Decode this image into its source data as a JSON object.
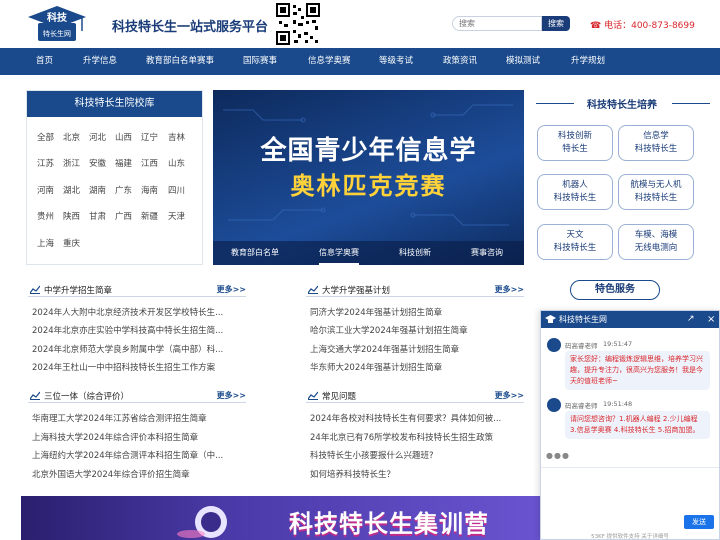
{
  "header": {
    "logo_text_top": "科技",
    "logo_text_bottom": "特长生网",
    "site_title": "科技特长生一站式服务平台",
    "search_placeholder": "搜索",
    "search_button": "搜索",
    "phone": "电话：400-873-8699"
  },
  "nav": [
    "首页",
    "升学信息",
    "教育部白名单赛事",
    "国际赛事",
    "信息学奥赛",
    "等级考试",
    "政策资讯",
    "模拟测试",
    "升学规划"
  ],
  "library": {
    "title": "科技特长生院校库",
    "provinces": [
      "全部",
      "北京",
      "河北",
      "山西",
      "辽宁",
      "吉林",
      "江苏",
      "浙江",
      "安徽",
      "福建",
      "江西",
      "山东",
      "河南",
      "湖北",
      "湖南",
      "广东",
      "海南",
      "四川",
      "贵州",
      "陕西",
      "甘肃",
      "广西",
      "新疆",
      "天津",
      "上海",
      "重庆"
    ]
  },
  "banner": {
    "line1": "全国青少年信息学",
    "line2": "奥林匹克竞赛",
    "tabs": [
      "教育部白名单",
      "信息学奥赛",
      "科技创新",
      "赛事咨询"
    ],
    "active_tab": "信息学奥赛"
  },
  "cultivation": {
    "title": "科技特长生培养",
    "items": [
      [
        "科技创新",
        "特长生"
      ],
      [
        "信息学",
        "科技特长生"
      ],
      [
        "机器人",
        "科技特长生"
      ],
      [
        "航模与无人机",
        "科技特长生"
      ],
      [
        "天文",
        "科技特长生"
      ],
      [
        "车模、海模",
        "无线电测向"
      ]
    ]
  },
  "sections": {
    "more_label": "更多>>",
    "middle_school": {
      "title": "中学升学招生简章",
      "items": [
        "2024年人大附中北京经济技术开发区学校特长生...",
        "2024年北京亦庄实验中学科技高中特长生招生简...",
        "2024年北京师范大学良乡附属中学（高中部）科...",
        "2024年王杜山一中中招科技特长生招生工作方案"
      ]
    },
    "university": {
      "title": "大学升学强基计划",
      "items": [
        "同济大学2024年强基计划招生简章",
        "哈尔滨工业大学2024年强基计划招生简章",
        "上海交通大学2024年强基计划招生简章",
        "华东师大2024年强基计划招生简章"
      ]
    },
    "comprehensive": {
      "title": "三位一体（综合评价）",
      "items": [
        "华南理工大学2024年江苏省综合测评招生简章",
        "上海科技大学2024年综合评价本科招生简章",
        "上海纽约大学2024年综合测评本科招生简章（中...",
        "北京外国语大学2024年综合评价招生简章"
      ]
    },
    "faq": {
      "title": "常见问题",
      "items": [
        "2024年各校对科技特长生有何要求？具体如何被...",
        "24年北京已有76所学校发布科技特长生招生政策",
        "科技特长生小孩要报什么兴趣班?",
        "如何培养科技特长生？"
      ]
    }
  },
  "features": {
    "title": "特色服务"
  },
  "bottom_banner": {
    "text": "科技特长生集训营"
  },
  "chat": {
    "title": "科技特长生网",
    "agent": "码高睿老师",
    "msg1_time": "19:51:47",
    "msg1": "家长您好：编程锻炼逻辑思维，培养学习兴趣，提升专注力，很高兴为您服务！我是今天的值班老师~",
    "msg2_time": "19:51:48",
    "msg2": "请问您想咨询？1.机器人编程 2.少儿编程 3.信息学奥赛 4.科技特长生 5.招商加盟。",
    "send": "发送",
    "footer": "53KF 提供软件支持  关于详细号"
  },
  "colors": {
    "primary": "#1a4a8c",
    "accent": "#d9262b",
    "banner_highlight": "#ffd23a"
  }
}
